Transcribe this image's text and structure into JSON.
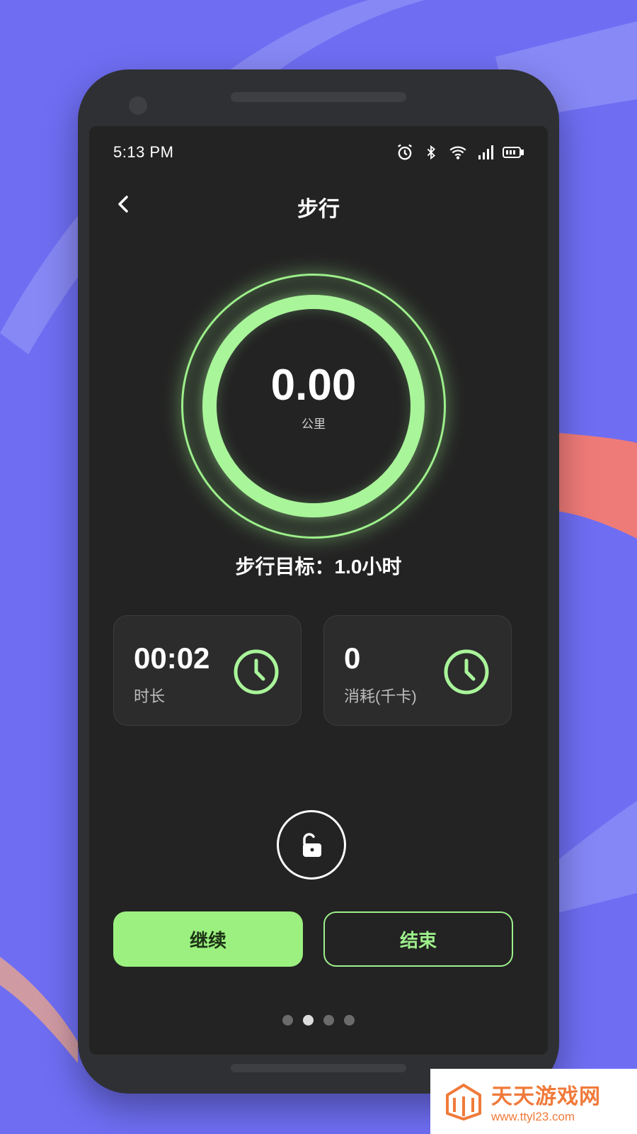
{
  "status_bar": {
    "time": "5:13 PM",
    "icons": [
      "alarm-icon",
      "bluetooth-icon",
      "wifi-icon",
      "signal-icon",
      "battery-icon"
    ]
  },
  "header": {
    "back_icon": "chevron-left-icon",
    "title": "步行"
  },
  "distance": {
    "value": "0.00",
    "unit": "公里"
  },
  "goal": {
    "text": "步行目标：1.0小时"
  },
  "stats": [
    {
      "value": "00:02",
      "label": "时长",
      "icon": "clock-icon"
    },
    {
      "value": "0",
      "label": "消耗(千卡)",
      "icon": "clock-icon"
    }
  ],
  "lock": {
    "icon": "unlock-icon"
  },
  "buttons": {
    "continue": "继续",
    "end": "结束"
  },
  "pagination": {
    "count": 4,
    "active_index": 1
  },
  "watermark": {
    "title": "天天游戏网",
    "url": "www.ttyl23.com"
  },
  "colors": {
    "background": "#6f6ef3",
    "accent_green": "#9cf07f",
    "screen_bg": "#232323"
  }
}
